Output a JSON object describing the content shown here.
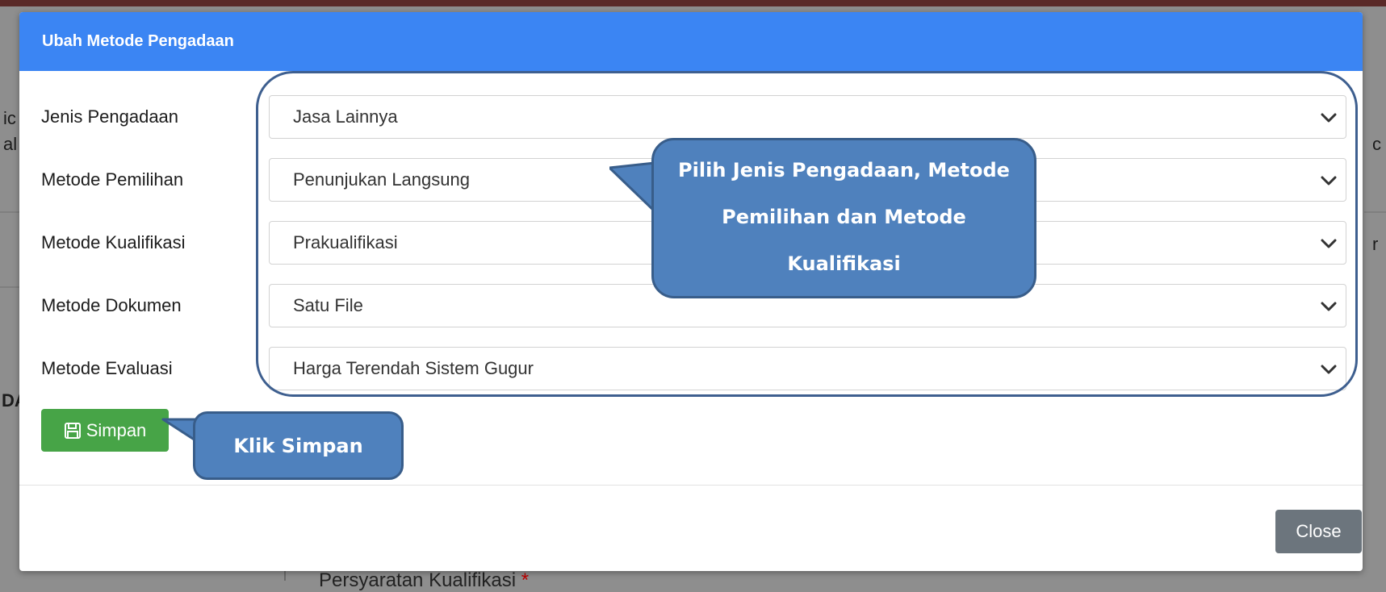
{
  "modal": {
    "title": "Ubah Metode Pengadaan",
    "fields": [
      {
        "label": "Jenis Pengadaan",
        "value": "Jasa Lainnya"
      },
      {
        "label": "Metode Pemilihan",
        "value": "Penunjukan Langsung"
      },
      {
        "label": "Metode Kualifikasi",
        "value": "Prakualifikasi"
      },
      {
        "label": "Metode Dokumen",
        "value": "Satu File"
      },
      {
        "label": "Metode Evaluasi",
        "value": "Harga Terendah Sistem Gugur"
      }
    ],
    "save_label": "Simpan",
    "close_label": "Close"
  },
  "annotations": {
    "main_callout_lines": [
      "Pilih Jenis Pengadaan, Metode",
      "Pemilihan dan Metode",
      "Kualifikasi"
    ],
    "save_callout": "Klik Simpan",
    "accent_color": "#4f81bd"
  },
  "background": {
    "footer_text": "Persyaratan Kualifikasi",
    "required_marker": "*",
    "fragments": [
      "ic",
      "al",
      "DA",
      "c",
      "r"
    ]
  },
  "icons": {
    "dropdown": "chevron-down-icon",
    "save": "floppy-disk-icon"
  },
  "colors": {
    "header": "#3b85f3",
    "save_button": "#47a447",
    "close_button": "#6c757d"
  }
}
